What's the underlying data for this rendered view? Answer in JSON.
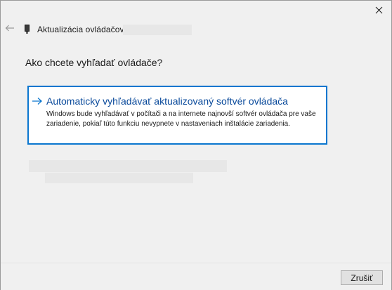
{
  "window": {
    "title": "Aktualizácia ovládačov"
  },
  "content": {
    "heading": "Ako chcete vyhľadať ovládače?",
    "option": {
      "title": "Automaticky vyhľadávať aktualizovaný softvér ovládača",
      "description": "Windows bude vyhľadávať v počítači a na internete najnovší softvér ovládača pre vaše zariadenie, pokiaľ túto funkciu nevypnete v nastaveniach inštalácie zariadenia."
    }
  },
  "footer": {
    "cancel_label": "Zrušiť"
  },
  "icons": {
    "close": "close-icon",
    "back": "back-arrow-icon",
    "device": "driver-device-icon",
    "option_arrow": "arrow-right-icon"
  },
  "colors": {
    "accent": "#0a76cf",
    "option_title": "#0a4a9b",
    "window_bg": "#f0f0f0"
  }
}
